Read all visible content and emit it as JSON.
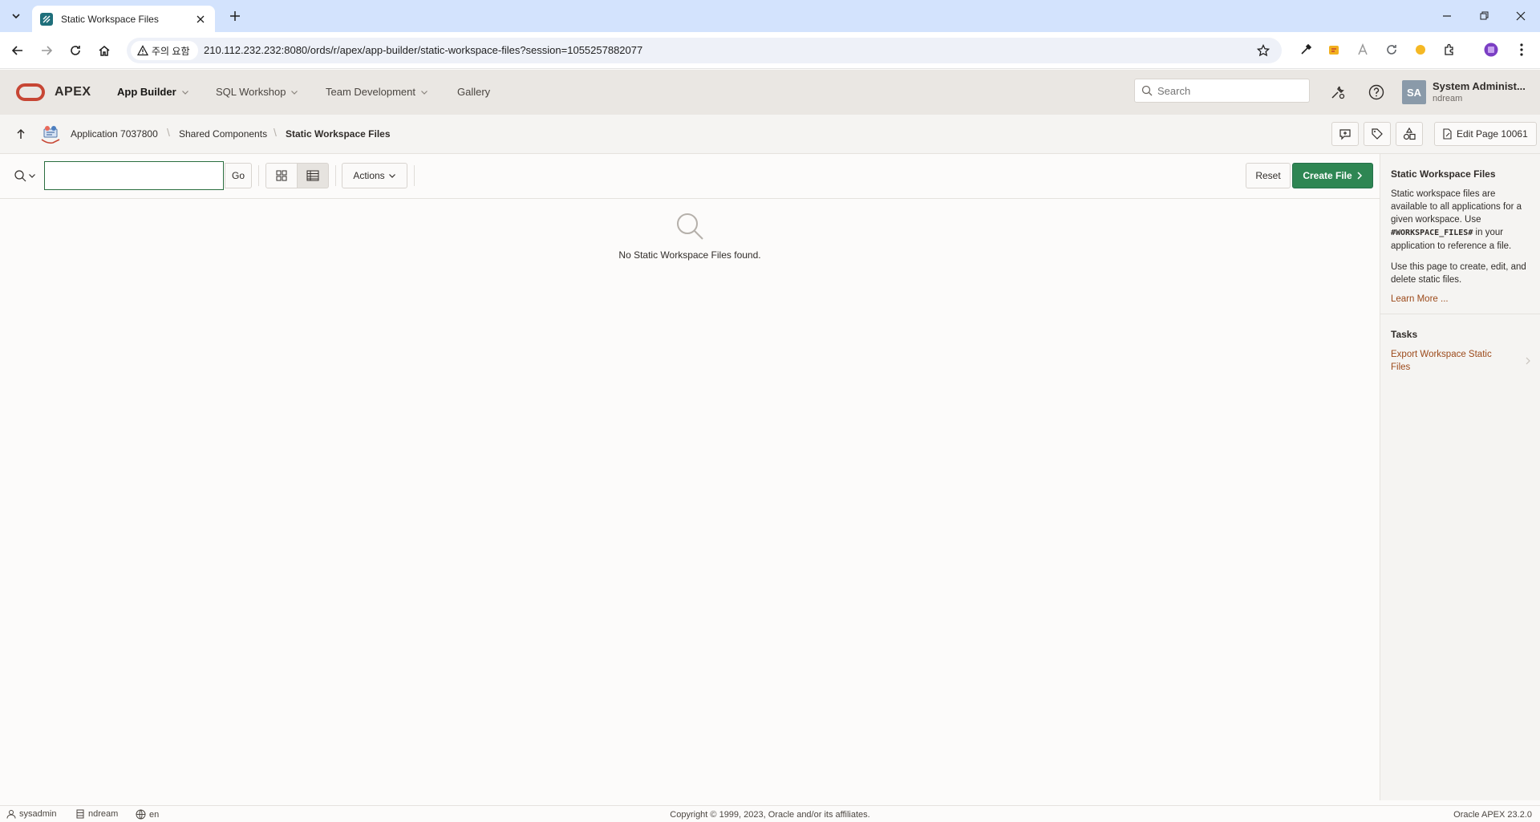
{
  "browser": {
    "tab_title": "Static Workspace Files",
    "security_label": "주의 요함",
    "url": "210.112.232.232:8080/ords/r/apex/app-builder/static-workspace-files?session=1055257882077"
  },
  "header": {
    "brand": "APEX",
    "nav": [
      {
        "label": "App Builder"
      },
      {
        "label": "SQL Workshop"
      },
      {
        "label": "Team Development"
      },
      {
        "label": "Gallery"
      }
    ],
    "search_placeholder": "Search",
    "avatar_initials": "SA",
    "user_name": "System Administ...",
    "workspace": "ndream"
  },
  "breadcrumb": {
    "items": [
      "Application 7037800",
      "Shared Components",
      "Static Workspace Files"
    ],
    "edit_page_label": "Edit Page 10061"
  },
  "toolbar": {
    "go_label": "Go",
    "actions_label": "Actions",
    "reset_label": "Reset",
    "create_label": "Create File"
  },
  "empty_state": {
    "message": "No Static Workspace Files found."
  },
  "sidebar": {
    "title": "Static Workspace Files",
    "p1_before": "Static workspace files are available to all applications for a given workspace. Use ",
    "p1_code": "#WORKSPACE_FILES#",
    "p1_after": " in your application to reference a file.",
    "p2": "Use this page to create, edit, and delete static files.",
    "learn_more": "Learn More ...",
    "tasks_title": "Tasks",
    "tasks": [
      "Export Workspace Static Files"
    ]
  },
  "footer": {
    "user": "sysadmin",
    "workspace": "ndream",
    "language": "en",
    "copyright": "Copyright © 1999, 2023, Oracle and/or its affiliates.",
    "version": "Oracle APEX 23.2.0"
  },
  "colors": {
    "primary_button": "#2e8653",
    "oracle_red": "#c74634",
    "link": "#9c4a1b",
    "header_bg": "#eae7e3"
  }
}
